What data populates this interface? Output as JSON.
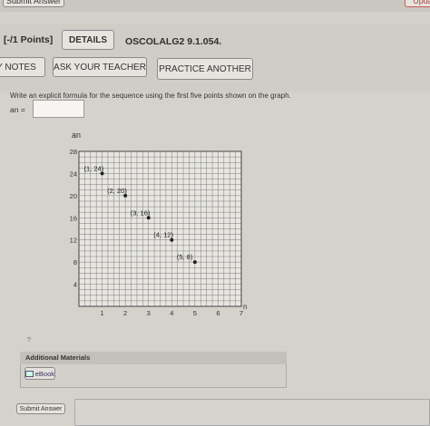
{
  "top": {
    "submit_label": "Submit Answer",
    "update_label": "Upda"
  },
  "header": {
    "points": "[-/1 Points]",
    "details_label": "DETAILS",
    "question_code": "OSCOLALG2 9.1.054."
  },
  "toolbar": {
    "notes_label": "Y NOTES",
    "ask_teacher_label": "ASK YOUR TEACHER",
    "practice_label": "PRACTICE ANOTHER"
  },
  "question": {
    "prompt": "Write an explicit formula for the sequence using the first five points shown on the graph.",
    "answer_label": "an =",
    "answer_value": ""
  },
  "chart_data": {
    "type": "scatter",
    "xlabel": "n",
    "ylabel": "an",
    "xlim": [
      0,
      7
    ],
    "ylim": [
      0,
      28
    ],
    "x_ticks": [
      "1",
      "2",
      "3",
      "4",
      "5",
      "6",
      "7"
    ],
    "y_ticks": [
      "4",
      "8",
      "12",
      "16",
      "20",
      "24",
      "28"
    ],
    "grid": true,
    "points": [
      {
        "x": 1,
        "y": 24,
        "label": "(1, 24)"
      },
      {
        "x": 2,
        "y": 20,
        "label": "(2, 20)"
      },
      {
        "x": 3,
        "y": 16,
        "label": "(3, 16)"
      },
      {
        "x": 4,
        "y": 12,
        "label": "(4, 12)"
      },
      {
        "x": 5,
        "y": 8,
        "label": "(5, 8)"
      }
    ]
  },
  "misc": {
    "question_mark": "?"
  },
  "additional": {
    "title": "Additional Materials",
    "ebook_label": "eBook"
  },
  "bottom": {
    "submit_label": "Submit Answer"
  }
}
